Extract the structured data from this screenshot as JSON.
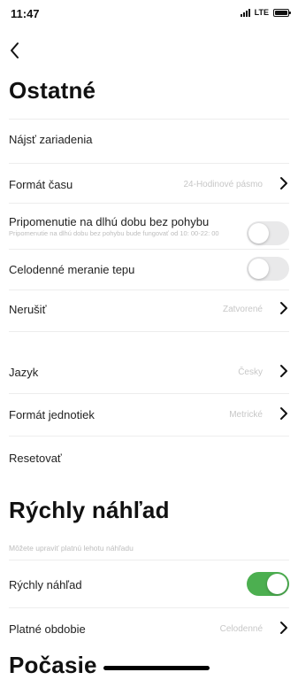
{
  "status": {
    "time": "11:47",
    "network": "LTE"
  },
  "section1": {
    "title": "Ostatné"
  },
  "rows": {
    "find_device": {
      "label": "Nájsť zariadenia"
    },
    "time_format": {
      "label": "Formát času",
      "value": "24-Hodinové pásmo"
    },
    "inactivity": {
      "label": "Pripomenutie na dlhú dobu bez pohybu",
      "sub": "Pripomenutie na dlhú dobu bez pohybu bude fungovať od 10: 00-22: 00",
      "toggle_on": false
    },
    "hr_monitor": {
      "label": "Celodenné meranie tepu",
      "toggle_on": false
    },
    "dnd": {
      "label": "Nerušiť",
      "value": "Zatvorené"
    },
    "language": {
      "label": "Jazyk",
      "value": "Česky"
    },
    "units": {
      "label": "Formát jednotiek",
      "value": "Metrické"
    },
    "reset": {
      "label": "Resetovať"
    }
  },
  "section2": {
    "title": "Rýchly náhľad",
    "note": "Môžete upraviť platnú lehotu náhľadu"
  },
  "quick_rows": {
    "quick_view": {
      "label": "Rýchly náhľad",
      "toggle_on": true
    },
    "valid_period": {
      "label": "Platné obdobie",
      "value": "Celodenné"
    }
  },
  "section3": {
    "title": "Počasie"
  },
  "colors": {
    "toggle_on": "#4caf50",
    "toggle_off": "#e9e9ea",
    "value_text": "#c7c7c7"
  }
}
